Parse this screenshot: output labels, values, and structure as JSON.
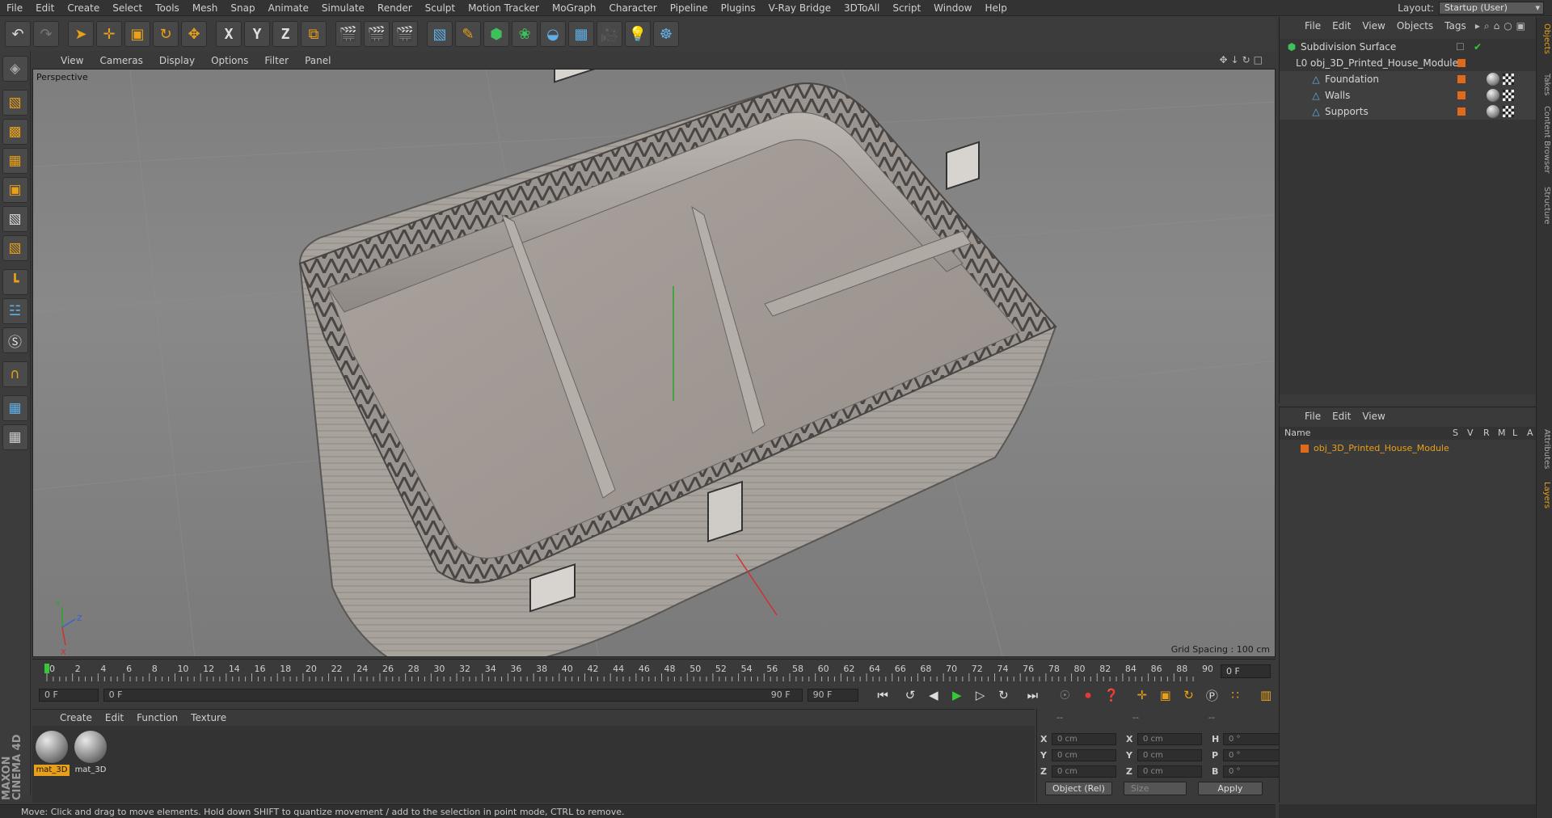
{
  "menu": [
    "File",
    "Edit",
    "Create",
    "Select",
    "Tools",
    "Mesh",
    "Snap",
    "Animate",
    "Simulate",
    "Render",
    "Sculpt",
    "Motion Tracker",
    "MoGraph",
    "Character",
    "Pipeline",
    "Plugins",
    "V-Ray Bridge",
    "3DToAll",
    "Script",
    "Window",
    "Help"
  ],
  "layout": {
    "label": "Layout:",
    "value": "Startup (User)"
  },
  "toolbar": {
    "axis_x": "X",
    "axis_y": "Y",
    "axis_z": "Z"
  },
  "viewport": {
    "menu": [
      "View",
      "Cameras",
      "Display",
      "Options",
      "Filter",
      "Panel"
    ],
    "label": "Perspective",
    "grid_spacing": "Grid Spacing : 100 cm",
    "axis_x": "X",
    "axis_y": "Y",
    "axis_z": "Z"
  },
  "timeline": {
    "ticks": [
      "0",
      "2",
      "4",
      "6",
      "8",
      "10",
      "12",
      "14",
      "16",
      "18",
      "20",
      "22",
      "24",
      "26",
      "28",
      "30",
      "32",
      "34",
      "36",
      "38",
      "40",
      "42",
      "44",
      "46",
      "48",
      "50",
      "52",
      "54",
      "56",
      "58",
      "60",
      "62",
      "64",
      "66",
      "68",
      "70",
      "72",
      "74",
      "76",
      "78",
      "80",
      "82",
      "84",
      "86",
      "88",
      "90"
    ],
    "current_frame": "0 F",
    "start_field": "0 F",
    "range_start": "0 F",
    "range_end": "90 F",
    "end_field": "90 F"
  },
  "materials": {
    "menu": [
      "Create",
      "Edit",
      "Function",
      "Texture"
    ],
    "items": [
      {
        "name": "mat_3D"
      },
      {
        "name": "mat_3D"
      }
    ]
  },
  "coords": {
    "header_left": "--",
    "header_mid": "--",
    "header_right": "--",
    "rows": [
      {
        "a": "X",
        "av": "0 cm",
        "b": "X",
        "bv": "0 cm",
        "c": "H",
        "cv": "0 °"
      },
      {
        "a": "Y",
        "av": "0 cm",
        "b": "Y",
        "bv": "0 cm",
        "c": "P",
        "cv": "0 °"
      },
      {
        "a": "Z",
        "av": "0 cm",
        "b": "Z",
        "bv": "0 cm",
        "c": "B",
        "cv": "0 °"
      }
    ],
    "mode": "Object (Rel)",
    "size": "Size",
    "apply": "Apply"
  },
  "status": "Move: Click and drag to move elements. Hold down SHIFT to quantize movement / add to the selection in point mode, CTRL to remove.",
  "objects": {
    "menu": [
      "File",
      "Edit",
      "View",
      "Objects",
      "Tags"
    ],
    "items": [
      {
        "name": "Subdivision Surface",
        "icon": "subdivision-icon"
      },
      {
        "name": "obj_3D_Printed_House_Module",
        "icon": "null-icon"
      },
      {
        "name": "Foundation",
        "icon": "polygon-icon"
      },
      {
        "name": "Walls",
        "icon": "polygon-icon"
      },
      {
        "name": "Supports",
        "icon": "polygon-icon"
      }
    ]
  },
  "layers": {
    "menu": [
      "File",
      "Edit",
      "View"
    ],
    "header": {
      "name": "Name",
      "s": "S",
      "v": "V",
      "r": "R",
      "m": "M",
      "l": "L",
      "a": "A"
    },
    "row": "obj_3D_Printed_House_Module"
  },
  "side_tabs": [
    "Objects",
    "Takes",
    "Content Browser",
    "Structure",
    "Attributes",
    "Layers"
  ],
  "colors": {
    "accent": "#e8a01a",
    "object_tag": "#e06a1a",
    "play": "#36c836"
  }
}
